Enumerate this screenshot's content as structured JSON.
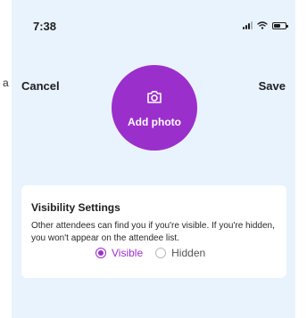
{
  "left_edge": {
    "letter": "a"
  },
  "status_bar": {
    "time": "7:38",
    "icons": [
      "signal-icon",
      "wifi-icon",
      "battery-icon"
    ]
  },
  "header": {
    "cancel_label": "Cancel",
    "save_label": "Save"
  },
  "photo": {
    "icon": "camera-icon",
    "label": "Add photo",
    "color": "#9b2fcc"
  },
  "visibility": {
    "title": "Visibility Settings",
    "description": "Other attendees can find you if you're visible. If you're hidden, you won't appear on the attendee list.",
    "options": [
      {
        "label": "Visible",
        "selected": true
      },
      {
        "label": "Hidden",
        "selected": false
      }
    ]
  },
  "colors": {
    "accent": "#9b2fcc",
    "screen_background": "#e9f3fd",
    "card_background": "#ffffff"
  }
}
